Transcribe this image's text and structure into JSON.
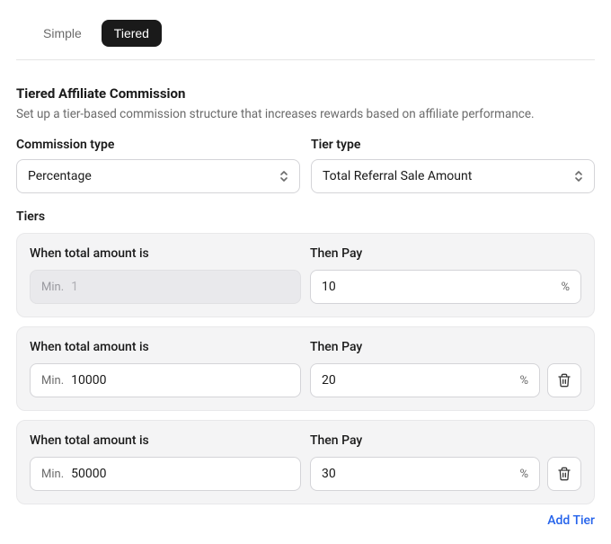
{
  "tabs": {
    "simple": "Simple",
    "tiered": "Tiered"
  },
  "section": {
    "title": "Tiered Affiliate Commission",
    "description": "Set up a tier-based commission structure that increases rewards based on affiliate performance."
  },
  "commission_type": {
    "label": "Commission type",
    "value": "Percentage"
  },
  "tier_type": {
    "label": "Tier type",
    "value": "Total Referral Sale Amount"
  },
  "tiers_label": "Tiers",
  "tier_labels": {
    "when": "When total amount is",
    "then": "Then Pay",
    "min_prefix": "Min.",
    "percent_suffix": "%"
  },
  "tiers": [
    {
      "min_placeholder": "1",
      "min_value": "",
      "pay_value": "10",
      "locked": true
    },
    {
      "min_placeholder": "",
      "min_value": "10000",
      "pay_value": "20",
      "locked": false
    },
    {
      "min_placeholder": "",
      "min_value": "50000",
      "pay_value": "30",
      "locked": false
    }
  ],
  "add_tier_label": "Add Tier"
}
